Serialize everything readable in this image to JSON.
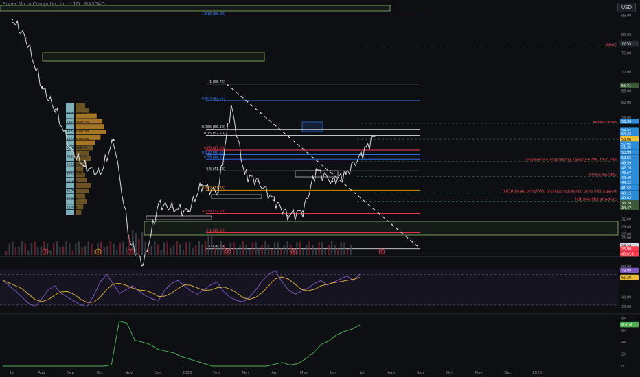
{
  "header": {
    "ticker_line": "Super Micro Computer, Inc. · 1D · NASDAQ",
    "currency": "USD"
  },
  "colors": {
    "background": "#0e0f13",
    "candle_up": "#d7d9de",
    "candle_down": "#8b8f99",
    "fib_line": "#d7d9de",
    "fib_blue": "#2f7bff",
    "fib_red": "#ff3b4e",
    "fib_orange": "#ff9800",
    "annotation_red": "#ff4d5e",
    "rsi": "#7e57c2",
    "rsi_ma": "#e8b93a",
    "obv": "#4caf50",
    "volume_profile": "#d89a2c",
    "volume_profile_va": "#9adbe8"
  },
  "chart_data": {
    "type": "line",
    "title": "Super Micro Computer, Inc. · 1D · NASDAQ",
    "xlabel": "",
    "ylabel": "",
    "x_ticks": [
      "Jul",
      "Aug",
      "Sep",
      "Oct",
      "Nov",
      "Dec",
      "2025",
      "Feb",
      "Mar",
      "Apr",
      "May",
      "Jun",
      "Jul",
      "Aug",
      "Sep",
      "Oct",
      "Nov",
      "Dec",
      "2026"
    ],
    "y_ticks": [
      "85.00",
      "80.00",
      "75.00",
      "70.00",
      "65.00",
      "62.00",
      "58.00",
      "54.00",
      "50.00",
      "47.00",
      "44.00",
      "41.00",
      "38.00",
      "36.00",
      "34.00",
      "31.00",
      "29.00",
      "27.00",
      "26.00",
      "24.10",
      "22.70"
    ],
    "ylim": [
      21.5,
      88
    ],
    "grid": false,
    "price_series": {
      "name": "",
      "x": [
        "2024-07-01",
        "2024-07-15",
        "2024-08-01",
        "2024-08-15",
        "2024-09-01",
        "2024-09-15",
        "2024-10-01",
        "2024-10-15",
        "2024-11-01",
        "2024-11-15",
        "2024-12-01",
        "2024-12-15",
        "2025-01-01",
        "2025-01-15",
        "2025-02-01",
        "2025-02-15",
        "2025-03-01",
        "2025-03-15",
        "2025-04-01",
        "2025-04-15",
        "2025-05-01",
        "2025-05-15",
        "2025-06-01",
        "2025-06-15",
        "2025-07-01",
        "2025-07-15"
      ],
      "values": [
        84,
        79,
        66,
        60,
        49,
        45,
        43,
        52,
        25,
        19,
        35,
        34,
        33,
        40,
        38,
        61,
        43,
        41,
        36,
        32,
        33,
        44,
        41,
        43,
        48,
        53
      ]
    },
    "fib_levels": [
      {
        "label": "1.618 (85.93)",
        "value": 84.8,
        "color": "#2f7bff"
      },
      {
        "label": "1 (66.76)",
        "value": 66.8,
        "color": "#d7d9de"
      },
      {
        "label": "0.904 (63.65)",
        "value": 62.4,
        "color": "#2f7bff"
      },
      {
        "label": "0.786 (56.30)",
        "value": 54.8,
        "color": "#d7d9de"
      },
      {
        "label": "0.75 (52.50)",
        "value": 53.2,
        "color": "#d7d9de"
      },
      {
        "label": "0.65 (47.80)",
        "value": 49.3,
        "color": "#ff3b4e"
      },
      {
        "label": "0.618 (46.28)",
        "value": 48.1,
        "color": "#2f7bff"
      },
      {
        "label": "0.58 (44.70)",
        "value": 46.9,
        "color": "#2f7bff"
      },
      {
        "label": "0.5 (41.53)",
        "value": 43.8,
        "color": "#d7d9de"
      },
      {
        "label": "0.382 (37.35)",
        "value": 38.7,
        "color": "#ff9800"
      },
      {
        "label": "0.236 (32.80)",
        "value": 32.5,
        "color": "#ff3b4e"
      },
      {
        "label": "0.1 (29.30)",
        "value": 27.4,
        "color": "#ff3b4e"
      },
      {
        "label": "0 (26.39)",
        "value": 23.2,
        "color": "#d7d9de"
      }
    ],
    "annotations": [
      {
        "text": "NPOC",
        "value": 76.6
      },
      {
        "text": "sweep range",
        "value": 56.4
      },
      {
        "text": "singleprint+vwapresting liquidity+VAH, fib 0.786",
        "value": 46.3
      },
      {
        "text": "resting liquidity",
        "value": 42.3
      },
      {
        "text": "0.618 single print/FVG: previous resistance turns into support",
        "value": 37.9
      },
      {
        "text": "left shoulder structure",
        "value": 35.8
      }
    ],
    "price_badges": [
      {
        "label": "77.55",
        "value": 77.5,
        "color": "#2a2c33"
      },
      {
        "label": "66.41",
        "value": 66.4,
        "color": "#3c5a3a"
      },
      {
        "label": "56.94",
        "value": 56.9,
        "color": "#2c8cd8"
      },
      {
        "label": "54.52",
        "value": 54.5,
        "color": "#2c8cd8"
      },
      {
        "label": "54.22",
        "value": 53.6,
        "color": "#2c8cd8"
      },
      {
        "label": "53.06",
        "value": 52.2,
        "color": "#f1c232"
      },
      {
        "label": "52.06",
        "value": 50.9,
        "color": "#2c8cd8"
      },
      {
        "label": "51.36",
        "value": 50.1,
        "color": "#2c8cd8"
      },
      {
        "label": "50.99",
        "value": 48.7,
        "color": "#2c8cd8"
      },
      {
        "label": "50.55",
        "value": 47.3,
        "color": "#2c8cd8"
      },
      {
        "label": "49.59",
        "value": 45.9,
        "color": "#2c8cd8"
      },
      {
        "label": "47.76",
        "value": 44.6,
        "color": "#2c8cd8"
      },
      {
        "label": "46.67",
        "value": 43.3,
        "color": "#2c8cd8"
      },
      {
        "label": "44.49",
        "value": 42.0,
        "color": "#2c8cd8"
      },
      {
        "label": "44.22",
        "value": 40.7,
        "color": "#2c8cd8"
      },
      {
        "label": "41.55",
        "value": 39.3,
        "color": "#2c8cd8"
      },
      {
        "label": "40.15",
        "value": 37.9,
        "color": "#2c8cd8"
      },
      {
        "label": "40.03",
        "value": 36.6,
        "color": "#2c8cd8"
      },
      {
        "label": "36.28",
        "value": 35.3,
        "color": "#3c5a3a"
      },
      {
        "label": "34.47",
        "value": 34.0,
        "color": "#3c5a3a"
      },
      {
        "label": "26.39",
        "value": 23.9,
        "color": "#d7d9de"
      },
      {
        "label": "25.99",
        "value": 23.1,
        "color": "#ff3b4e"
      },
      {
        "label": "40.618",
        "value": 21.7,
        "color": "#ff3b4e"
      }
    ],
    "rsi": {
      "y_ticks": [
        "80.00",
        "40.00",
        "28.00"
      ],
      "last_value": "73.09",
      "ma_value": "61.28",
      "values": [
        62,
        55,
        48,
        40,
        32,
        28,
        38,
        50,
        55,
        45,
        40,
        35,
        30,
        28,
        42,
        60,
        70,
        58,
        45,
        50,
        55,
        48,
        42,
        38,
        36,
        50,
        58,
        62,
        55,
        48,
        44,
        50,
        56,
        60,
        48,
        40,
        36,
        34,
        40,
        50,
        62,
        70,
        75,
        60,
        50,
        44,
        48,
        52,
        58,
        62,
        56,
        60,
        64,
        68,
        62,
        70
      ]
    },
    "obv": {
      "y_ticks": [
        "8M",
        "6M",
        "4M",
        "2M",
        "0"
      ],
      "last_value": "6.91M",
      "values": [
        0,
        0,
        0,
        0,
        0,
        0,
        0,
        0,
        0,
        0,
        0,
        0,
        0,
        0,
        0.2,
        7.5,
        7.2,
        4.3,
        4.0,
        3.6,
        2.8,
        2.5,
        2.2,
        1.6,
        1.2,
        0.8,
        0.4,
        0,
        0,
        0,
        0,
        0,
        0,
        0,
        0,
        0.3,
        0.6,
        0.2,
        0.4,
        1.2,
        2.2,
        3.6,
        4.2,
        5.2,
        5.8,
        6.2,
        6.9
      ]
    },
    "volume_profile_labels": [
      "73.43M/88.9%",
      "108.84M/95.7%",
      "129.5M/107.9%",
      "132.1M/104.9%",
      "66.31M/88.7%",
      "68.28M/60.2%",
      "75.12M/66.6%",
      "104.8M/70.9%",
      "59.31M",
      "51.7M",
      "55.18M",
      "52.44M"
    ],
    "event_markers": [
      "E",
      "S",
      "E",
      "E",
      "E",
      "E"
    ]
  }
}
